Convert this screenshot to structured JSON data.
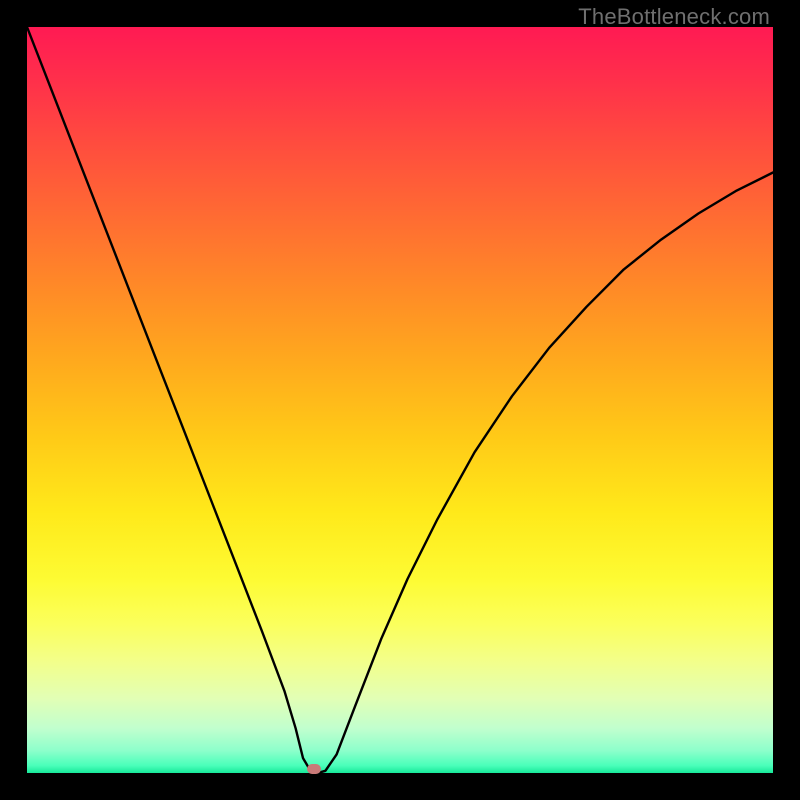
{
  "watermark": {
    "text": "TheBottleneck.com"
  },
  "chart_data": {
    "type": "line",
    "title": "",
    "xlabel": "",
    "ylabel": "",
    "xlim": [
      0,
      1
    ],
    "ylim": [
      0,
      1
    ],
    "min_point": {
      "x": 0.385,
      "y": 0.0
    },
    "curve_left": [
      {
        "x": 0.0,
        "y": 1.0
      },
      {
        "x": 0.035,
        "y": 0.91
      },
      {
        "x": 0.07,
        "y": 0.82
      },
      {
        "x": 0.105,
        "y": 0.73
      },
      {
        "x": 0.14,
        "y": 0.64
      },
      {
        "x": 0.175,
        "y": 0.55
      },
      {
        "x": 0.21,
        "y": 0.46
      },
      {
        "x": 0.245,
        "y": 0.37
      },
      {
        "x": 0.28,
        "y": 0.28
      },
      {
        "x": 0.315,
        "y": 0.19
      },
      {
        "x": 0.345,
        "y": 0.11
      },
      {
        "x": 0.36,
        "y": 0.06
      },
      {
        "x": 0.37,
        "y": 0.02
      },
      {
        "x": 0.38,
        "y": 0.003
      },
      {
        "x": 0.39,
        "y": 0.0
      }
    ],
    "curve_right": [
      {
        "x": 0.39,
        "y": 0.0
      },
      {
        "x": 0.4,
        "y": 0.003
      },
      {
        "x": 0.415,
        "y": 0.025
      },
      {
        "x": 0.44,
        "y": 0.09
      },
      {
        "x": 0.475,
        "y": 0.18
      },
      {
        "x": 0.51,
        "y": 0.26
      },
      {
        "x": 0.55,
        "y": 0.34
      },
      {
        "x": 0.6,
        "y": 0.43
      },
      {
        "x": 0.65,
        "y": 0.505
      },
      {
        "x": 0.7,
        "y": 0.57
      },
      {
        "x": 0.75,
        "y": 0.625
      },
      {
        "x": 0.8,
        "y": 0.675
      },
      {
        "x": 0.85,
        "y": 0.715
      },
      {
        "x": 0.9,
        "y": 0.75
      },
      {
        "x": 0.95,
        "y": 0.78
      },
      {
        "x": 1.0,
        "y": 0.805
      }
    ],
    "gradient_stops": [
      {
        "pos": 0.0,
        "color": "#ff1a53"
      },
      {
        "pos": 0.25,
        "color": "#ff6a33"
      },
      {
        "pos": 0.55,
        "color": "#ffca17"
      },
      {
        "pos": 0.8,
        "color": "#fbff5c"
      },
      {
        "pos": 1.0,
        "color": "#17e89a"
      }
    ]
  }
}
